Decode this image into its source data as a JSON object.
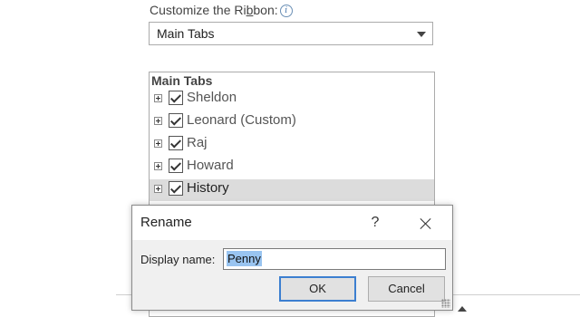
{
  "customize": {
    "label_prefix": "Customize the Ri",
    "label_accel": "b",
    "label_suffix": "bon:",
    "info_icon_glyph": "i",
    "combo_value": "Main Tabs"
  },
  "tree": {
    "header": "Main Tabs",
    "items": [
      {
        "label": "Sheldon",
        "checked": true
      },
      {
        "label": "Leonard (Custom)",
        "checked": true
      },
      {
        "label": "Raj",
        "checked": true
      },
      {
        "label": "Howard",
        "checked": true
      },
      {
        "label": "History",
        "checked": true,
        "selected": true
      }
    ]
  },
  "dialog": {
    "title": "Rename",
    "help_label": "?",
    "field_label": "Display name:",
    "field_value": "Penny",
    "ok_label": "OK",
    "cancel_label": "Cancel"
  },
  "colors": {
    "selection": "#99c4f0",
    "default_button_border": "#3c7fd0",
    "selected_row": "#dcdcdc"
  }
}
